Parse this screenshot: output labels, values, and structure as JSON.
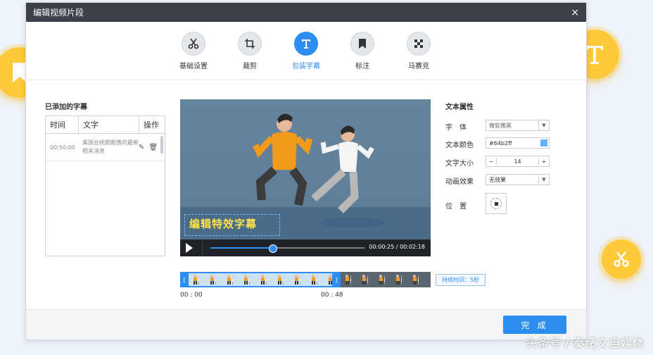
{
  "dialog": {
    "title": "编辑视频片段",
    "close_label": "×"
  },
  "toolbar": {
    "tabs": [
      {
        "label": "基础设置",
        "icon": "scissors-icon"
      },
      {
        "label": "裁剪",
        "icon": "crop-icon"
      },
      {
        "label": "包装字幕",
        "icon": "text-icon",
        "active": true
      },
      {
        "label": "标注",
        "icon": "bookmark-icon"
      },
      {
        "label": "马赛克",
        "icon": "mosaic-icon"
      }
    ]
  },
  "subtitles": {
    "heading": "已添加的字幕",
    "columns": [
      "时间",
      "文字",
      "操作"
    ],
    "rows": [
      {
        "time": "00:50:00",
        "text": "美国总统朗朗普的最新相关消息"
      }
    ]
  },
  "video": {
    "caption": "编辑特效字幕",
    "time_readout": "00:00:25 / 00:02:18",
    "progress": 0.4
  },
  "timeline": {
    "start": "00 : 00",
    "end": "00 : 48",
    "duration_label": "持续时间：5秒",
    "selected_fraction": 0.64
  },
  "properties": {
    "heading": "文本属性",
    "font_label": "字　体",
    "font_value": "微软雅黑",
    "color_label": "文本颜色",
    "color_value": "#64b2ff",
    "size_label": "文字大小",
    "size_value": "14",
    "animation_label": "动画效果",
    "animation_value": "无效果",
    "position_label": "位　置"
  },
  "footer": {
    "done_label": "完 成"
  },
  "watermark": "头条号 / 秦绪文自媒体",
  "colors": {
    "accent": "#2d8ef2",
    "deco": "#fec93a",
    "titlebar": "#3c4049"
  }
}
